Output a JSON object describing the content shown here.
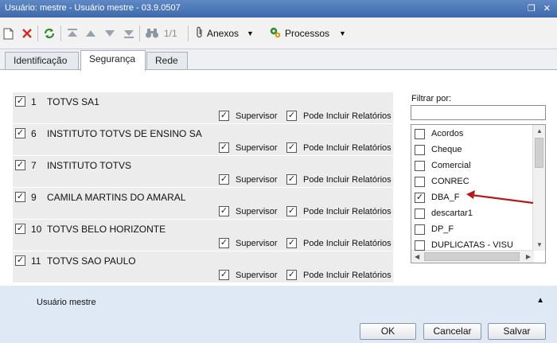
{
  "window": {
    "title": "Usuário: mestre - Usuário mestre - 03.9.0507"
  },
  "toolbar": {
    "new_icon": "new-document-icon",
    "delete_icon": "delete-x-icon",
    "refresh_icon": "refresh-icon",
    "record_position": "1/1",
    "attachments_label": "Anexos",
    "processes_label": "Processos"
  },
  "tabs": [
    {
      "label": "Identificação"
    },
    {
      "label": "Segurança"
    },
    {
      "label": "Rede"
    }
  ],
  "entries": [
    {
      "code": "1",
      "name": "TOTVS SA1",
      "checked": true,
      "supervisor_label": "Supervisor",
      "reports_label": "Pode Incluir Relatórios",
      "supervisor": true,
      "reports": true
    },
    {
      "code": "6",
      "name": "INSTITUTO TOTVS DE ENSINO SA",
      "checked": true,
      "supervisor_label": "Supervisor",
      "reports_label": "Pode Incluir Relatórios",
      "supervisor": true,
      "reports": true
    },
    {
      "code": "7",
      "name": "INSTITUTO TOTVS",
      "checked": true,
      "supervisor_label": "Supervisor",
      "reports_label": "Pode Incluir Relatórios",
      "supervisor": true,
      "reports": true
    },
    {
      "code": "9",
      "name": "CAMILA MARTINS DO AMARAL",
      "checked": true,
      "supervisor_label": "Supervisor",
      "reports_label": "Pode Incluir Relatórios",
      "supervisor": true,
      "reports": true
    },
    {
      "code": "10",
      "name": "TOTVS BELO HORIZONTE",
      "checked": true,
      "supervisor_label": "Supervisor",
      "reports_label": "Pode Incluir Relatórios",
      "supervisor": true,
      "reports": true
    },
    {
      "code": "11",
      "name": "TOTVS SAO PAULO",
      "checked": true,
      "supervisor_label": "Supervisor",
      "reports_label": "Pode Incluir Relatórios",
      "supervisor": true,
      "reports": true
    }
  ],
  "filter": {
    "label": "Filtrar por:",
    "value": "",
    "items": [
      {
        "label": "Acordos",
        "checked": false
      },
      {
        "label": "Cheque",
        "checked": false
      },
      {
        "label": "Comercial",
        "checked": false
      },
      {
        "label": "CONREC",
        "checked": false
      },
      {
        "label": "DBA_F",
        "checked": true
      },
      {
        "label": "descartar1",
        "checked": false
      },
      {
        "label": "DP_F",
        "checked": false
      },
      {
        "label": "DUPLICATAS - VISU",
        "checked": false
      }
    ]
  },
  "status": {
    "user": "Usuário mestre"
  },
  "buttons": {
    "ok": "OK",
    "cancel": "Cancelar",
    "save": "Salvar"
  },
  "colors": {
    "accent": "#3d6aab",
    "arrow": "#b31b1b",
    "delete": "#d62828",
    "refresh": "#2e8b2e"
  }
}
